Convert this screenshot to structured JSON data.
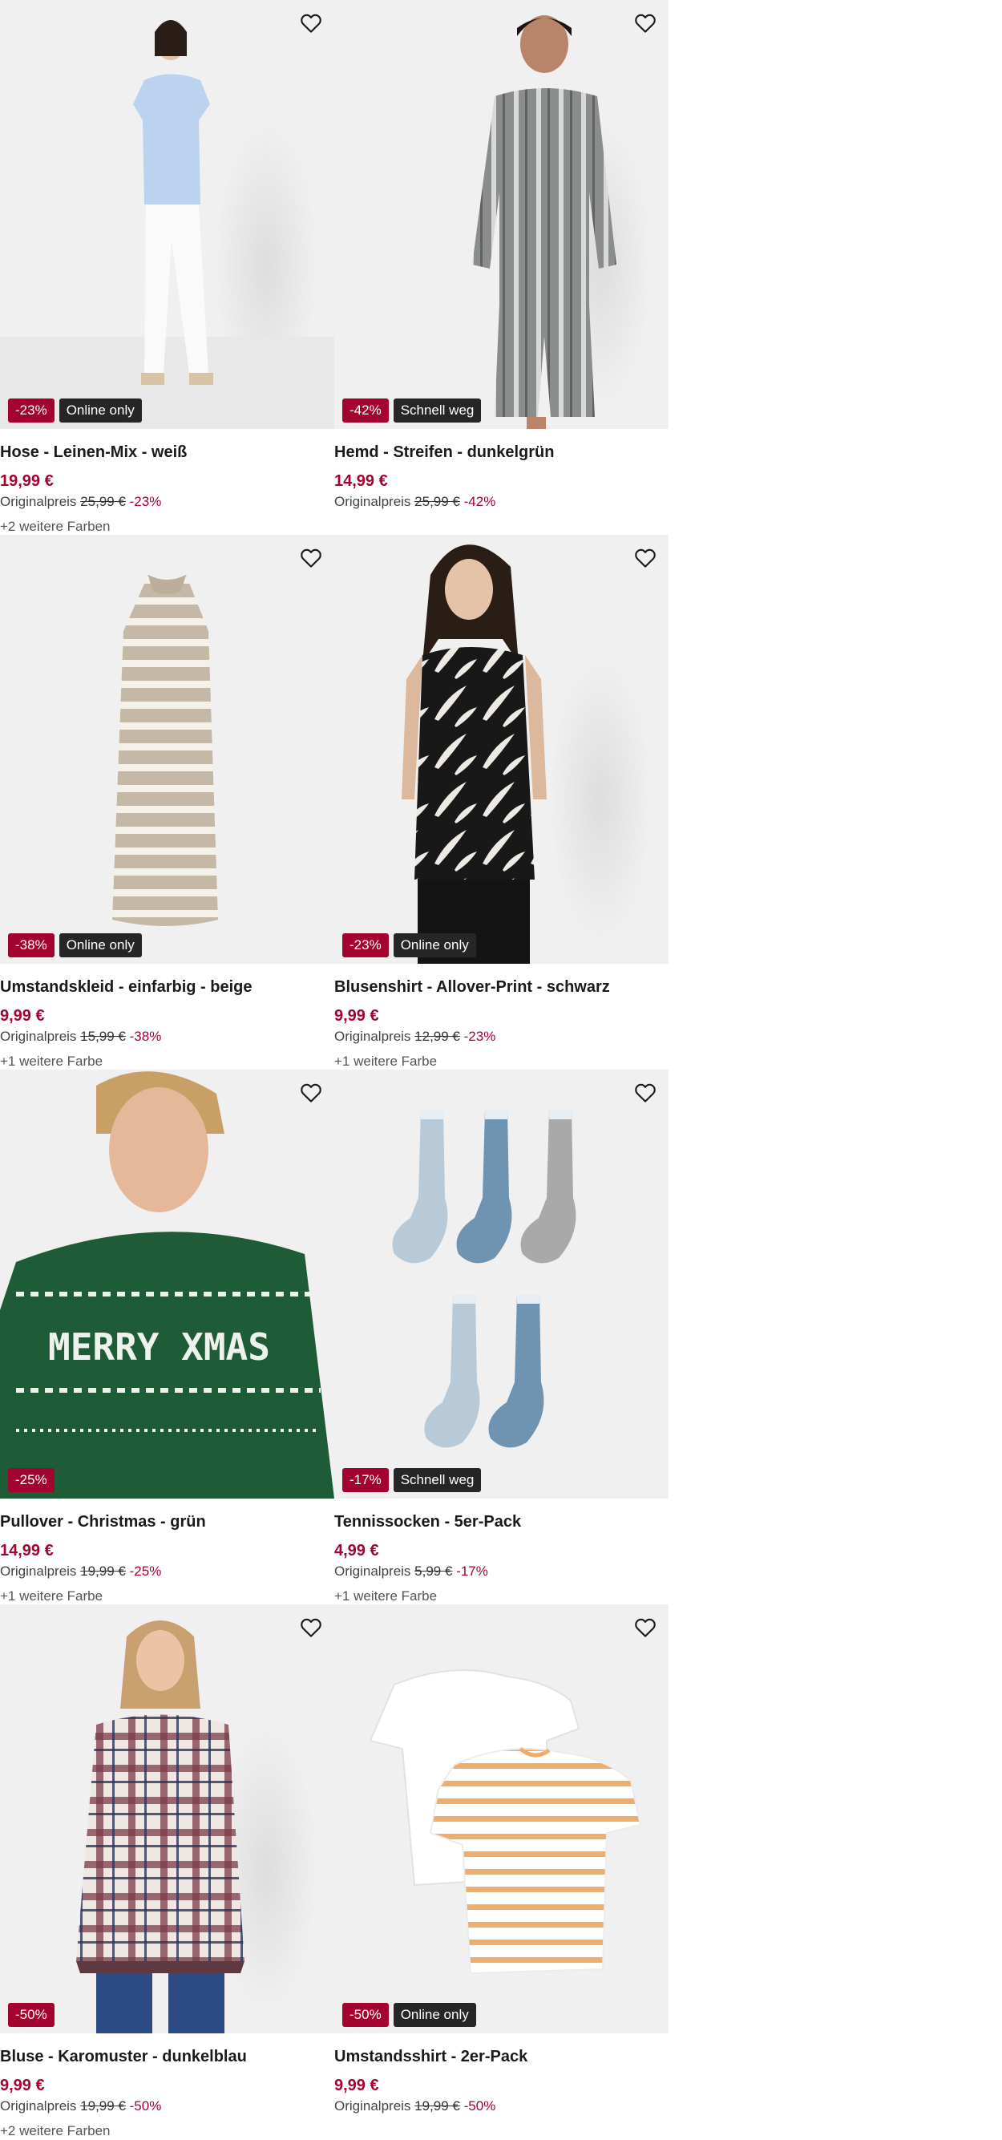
{
  "products": [
    {
      "title": "Hose - Leinen-Mix - weiß",
      "price": "19,99 €",
      "orig_label": "Originalpreis",
      "orig_price": "25,99 €",
      "discount": "-23%",
      "badge_discount": "-23%",
      "badge_info": "Online only",
      "colors": "+2 weitere Farben"
    },
    {
      "title": "Hemd - Streifen - dunkelgrün",
      "price": "14,99 €",
      "orig_label": "Originalpreis",
      "orig_price": "25,99 €",
      "discount": "-42%",
      "badge_discount": "-42%",
      "badge_info": "Schnell weg",
      "colors": ""
    },
    {
      "title": "Umstandskleid - einfarbig - beige",
      "price": "9,99 €",
      "orig_label": "Originalpreis",
      "orig_price": "15,99 €",
      "discount": "-38%",
      "badge_discount": "-38%",
      "badge_info": "Online only",
      "colors": "+1 weitere Farbe"
    },
    {
      "title": "Blusenshirt - Allover-Print - schwarz",
      "price": "9,99 €",
      "orig_label": "Originalpreis",
      "orig_price": "12,99 €",
      "discount": "-23%",
      "badge_discount": "-23%",
      "badge_info": "Online only",
      "colors": "+1 weitere Farbe"
    },
    {
      "title": "Pullover - Christmas - grün",
      "price": "14,99 €",
      "orig_label": "Originalpreis",
      "orig_price": "19,99 €",
      "discount": "-25%",
      "badge_discount": "-25%",
      "badge_info": "",
      "colors": "+1 weitere Farbe",
      "print_text": "MERRY XMAS"
    },
    {
      "title": "Tennissocken - 5er-Pack",
      "price": "4,99 €",
      "orig_label": "Originalpreis",
      "orig_price": "5,99 €",
      "discount": "-17%",
      "badge_discount": "-17%",
      "badge_info": "Schnell weg",
      "colors": "+1 weitere Farbe"
    },
    {
      "title": "Bluse - Karomuster - dunkelblau",
      "price": "9,99 €",
      "orig_label": "Originalpreis",
      "orig_price": "19,99 €",
      "discount": "-50%",
      "badge_discount": "-50%",
      "badge_info": "",
      "colors": "+2 weitere Farben"
    },
    {
      "title": "Umstandsshirt - 2er-Pack",
      "price": "9,99 €",
      "orig_label": "Originalpreis",
      "orig_price": "19,99 €",
      "discount": "-50%",
      "badge_discount": "-50%",
      "badge_info": "Online only",
      "colors": ""
    }
  ],
  "icons": {
    "wishlist": "heart-outline-icon"
  },
  "colors": {
    "accent": "#a4032f",
    "badge_dark": "#262626",
    "image_bg": "#f0f0f0"
  }
}
